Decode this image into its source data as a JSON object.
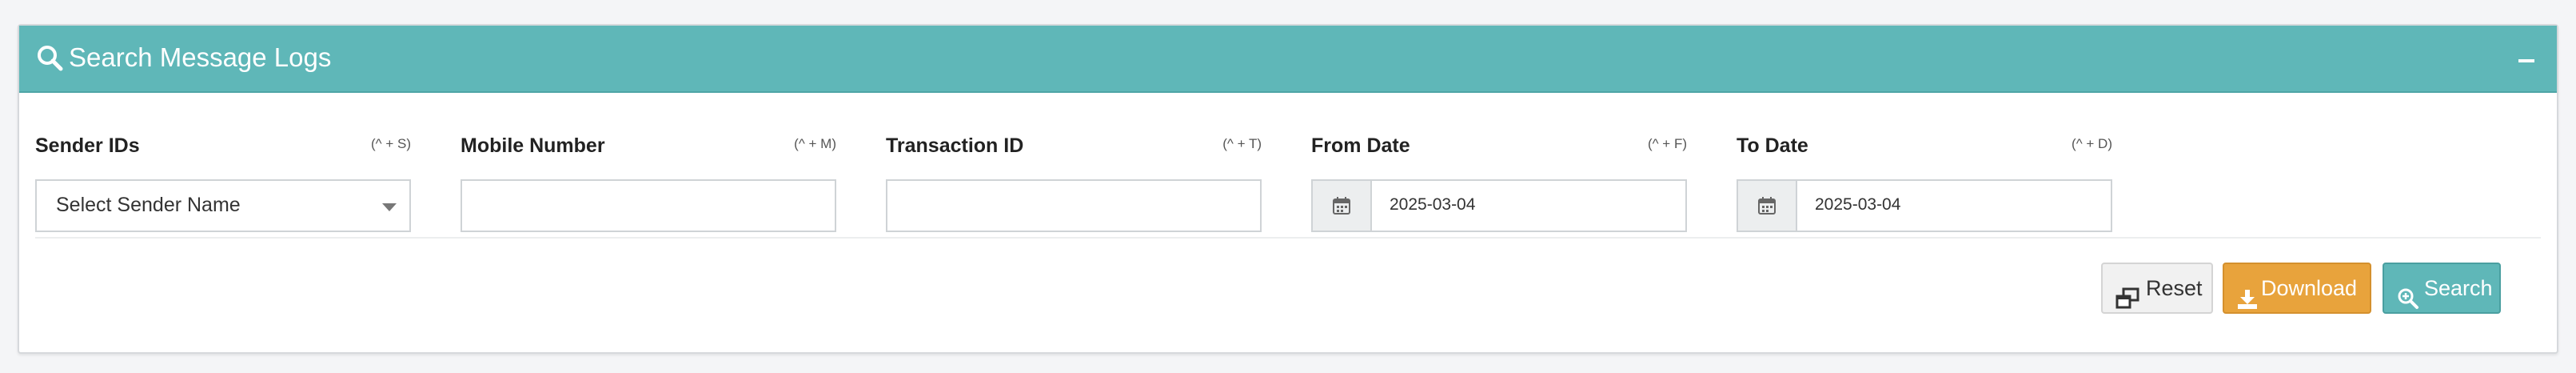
{
  "panel": {
    "title": "Search Message Logs",
    "header_color": "#5fb7b8",
    "header_icon": "search-icon",
    "collapse_icon": "minus-icon"
  },
  "filters": {
    "sender": {
      "label": "Sender IDs",
      "shortcut": "(^ + S)",
      "selected": "Select Sender Name"
    },
    "mobile": {
      "label": "Mobile Number",
      "shortcut": "(^ + M)",
      "value": ""
    },
    "transaction": {
      "label": "Transaction ID",
      "shortcut": "(^ + T)",
      "value": ""
    },
    "from_date": {
      "label": "From Date",
      "shortcut": "(^ + F)",
      "value": "2025-03-04",
      "icon": "calendar-icon"
    },
    "to_date": {
      "label": "To Date",
      "shortcut": "(^ + D)",
      "value": "2025-03-04",
      "icon": "calendar-icon"
    }
  },
  "actions": {
    "reset_label": "Reset",
    "download_label": "Download",
    "search_label": "Search",
    "download_color": "#e8a33c",
    "search_color": "#5fb7b8"
  }
}
